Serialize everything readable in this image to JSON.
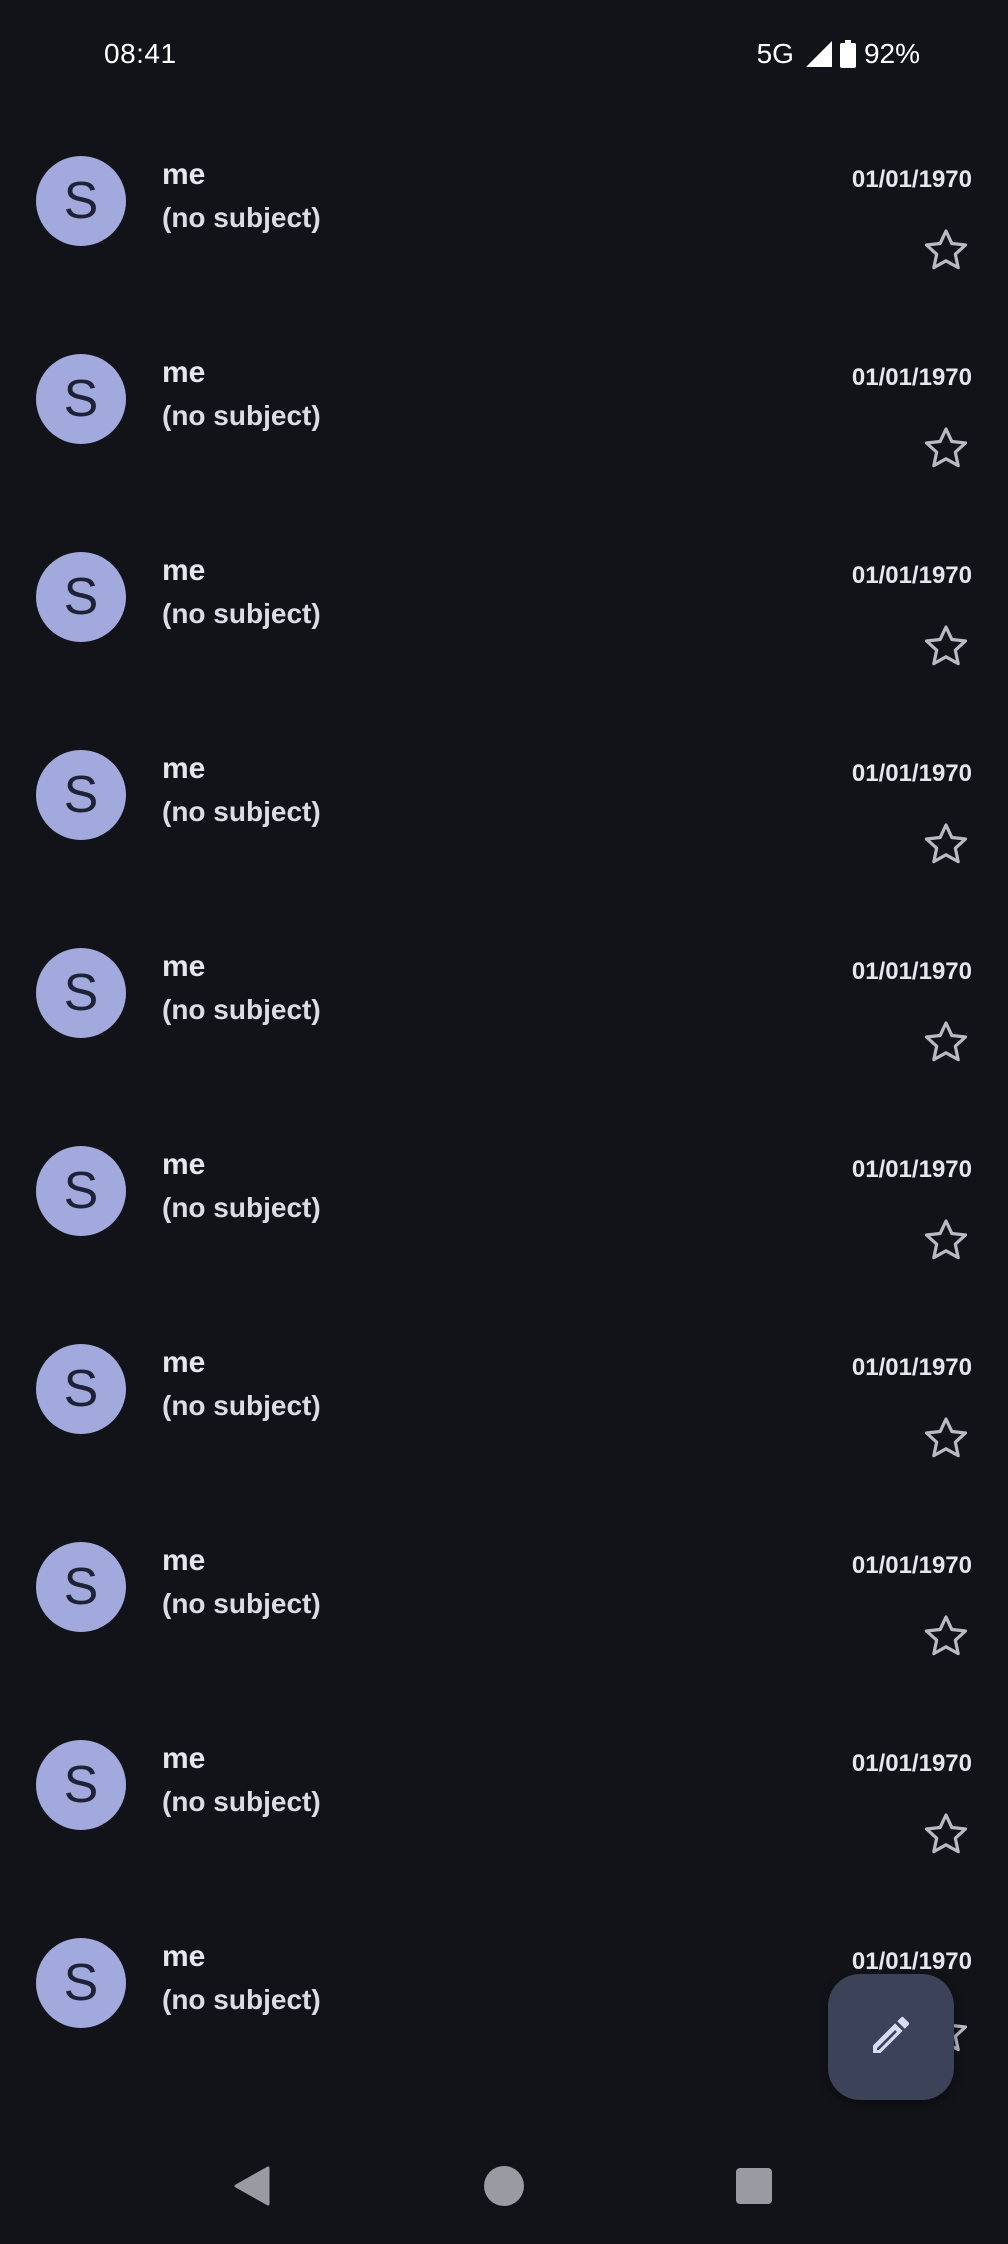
{
  "status_bar": {
    "time": "08:41",
    "network": "5G",
    "battery": "92%",
    "signal_icon": "signal-icon",
    "battery_icon": "battery-icon"
  },
  "colors": {
    "background": "#121318",
    "avatar_bg": "#a2a9dc",
    "fab_bg": "#3c4257"
  },
  "mail_list": {
    "items": [
      {
        "avatar": "S",
        "sender": "me",
        "subject": "(no subject)",
        "date": "01/01/1970",
        "starred": false
      },
      {
        "avatar": "S",
        "sender": "me",
        "subject": "(no subject)",
        "date": "01/01/1970",
        "starred": false
      },
      {
        "avatar": "S",
        "sender": "me",
        "subject": "(no subject)",
        "date": "01/01/1970",
        "starred": false
      },
      {
        "avatar": "S",
        "sender": "me",
        "subject": "(no subject)",
        "date": "01/01/1970",
        "starred": false
      },
      {
        "avatar": "S",
        "sender": "me",
        "subject": "(no subject)",
        "date": "01/01/1970",
        "starred": false
      },
      {
        "avatar": "S",
        "sender": "me",
        "subject": "(no subject)",
        "date": "01/01/1970",
        "starred": false
      },
      {
        "avatar": "S",
        "sender": "me",
        "subject": "(no subject)",
        "date": "01/01/1970",
        "starred": false
      },
      {
        "avatar": "S",
        "sender": "me",
        "subject": "(no subject)",
        "date": "01/01/1970",
        "starred": false
      },
      {
        "avatar": "S",
        "sender": "me",
        "subject": "(no subject)",
        "date": "01/01/1970",
        "starred": false
      },
      {
        "avatar": "S",
        "sender": "me",
        "subject": "(no subject)",
        "date": "01/01/1970",
        "starred": false
      }
    ]
  },
  "fab": {
    "icon": "pencil-icon"
  },
  "nav_bar": {
    "back_icon": "back-icon",
    "home_icon": "home-icon",
    "recents_icon": "recents-icon"
  }
}
